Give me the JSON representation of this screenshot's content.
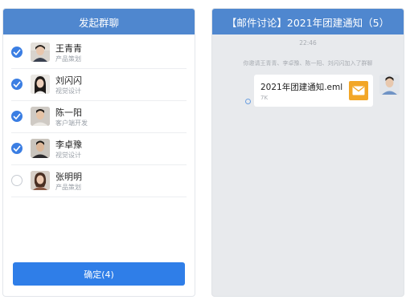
{
  "left_panel": {
    "title": "发起群聊",
    "members": [
      {
        "name": "王青青",
        "role": "产品策划",
        "checked": true
      },
      {
        "name": "刘闪闪",
        "role": "视觉设计",
        "checked": true
      },
      {
        "name": "陈一阳",
        "role": "客户端开发",
        "checked": true
      },
      {
        "name": "李卓豫",
        "role": "视觉设计",
        "checked": true
      },
      {
        "name": "张明明",
        "role": "产品策划",
        "checked": false
      }
    ],
    "confirm_label": "确定(4)"
  },
  "right_panel": {
    "title": "【邮件讨论】2021年团建通知（5）",
    "time": "22:46",
    "system_message": "你邀请王青青、李卓豫、陈一阳、刘闪闪加入了群聊",
    "file": {
      "name": "2021年团建通知.eml",
      "size": "7K",
      "icon": "mail-icon"
    }
  },
  "colors": {
    "header": "#4f87cf",
    "accent": "#3b7ee3",
    "button": "#2f7ee8",
    "file_icon": "#f2a627"
  }
}
